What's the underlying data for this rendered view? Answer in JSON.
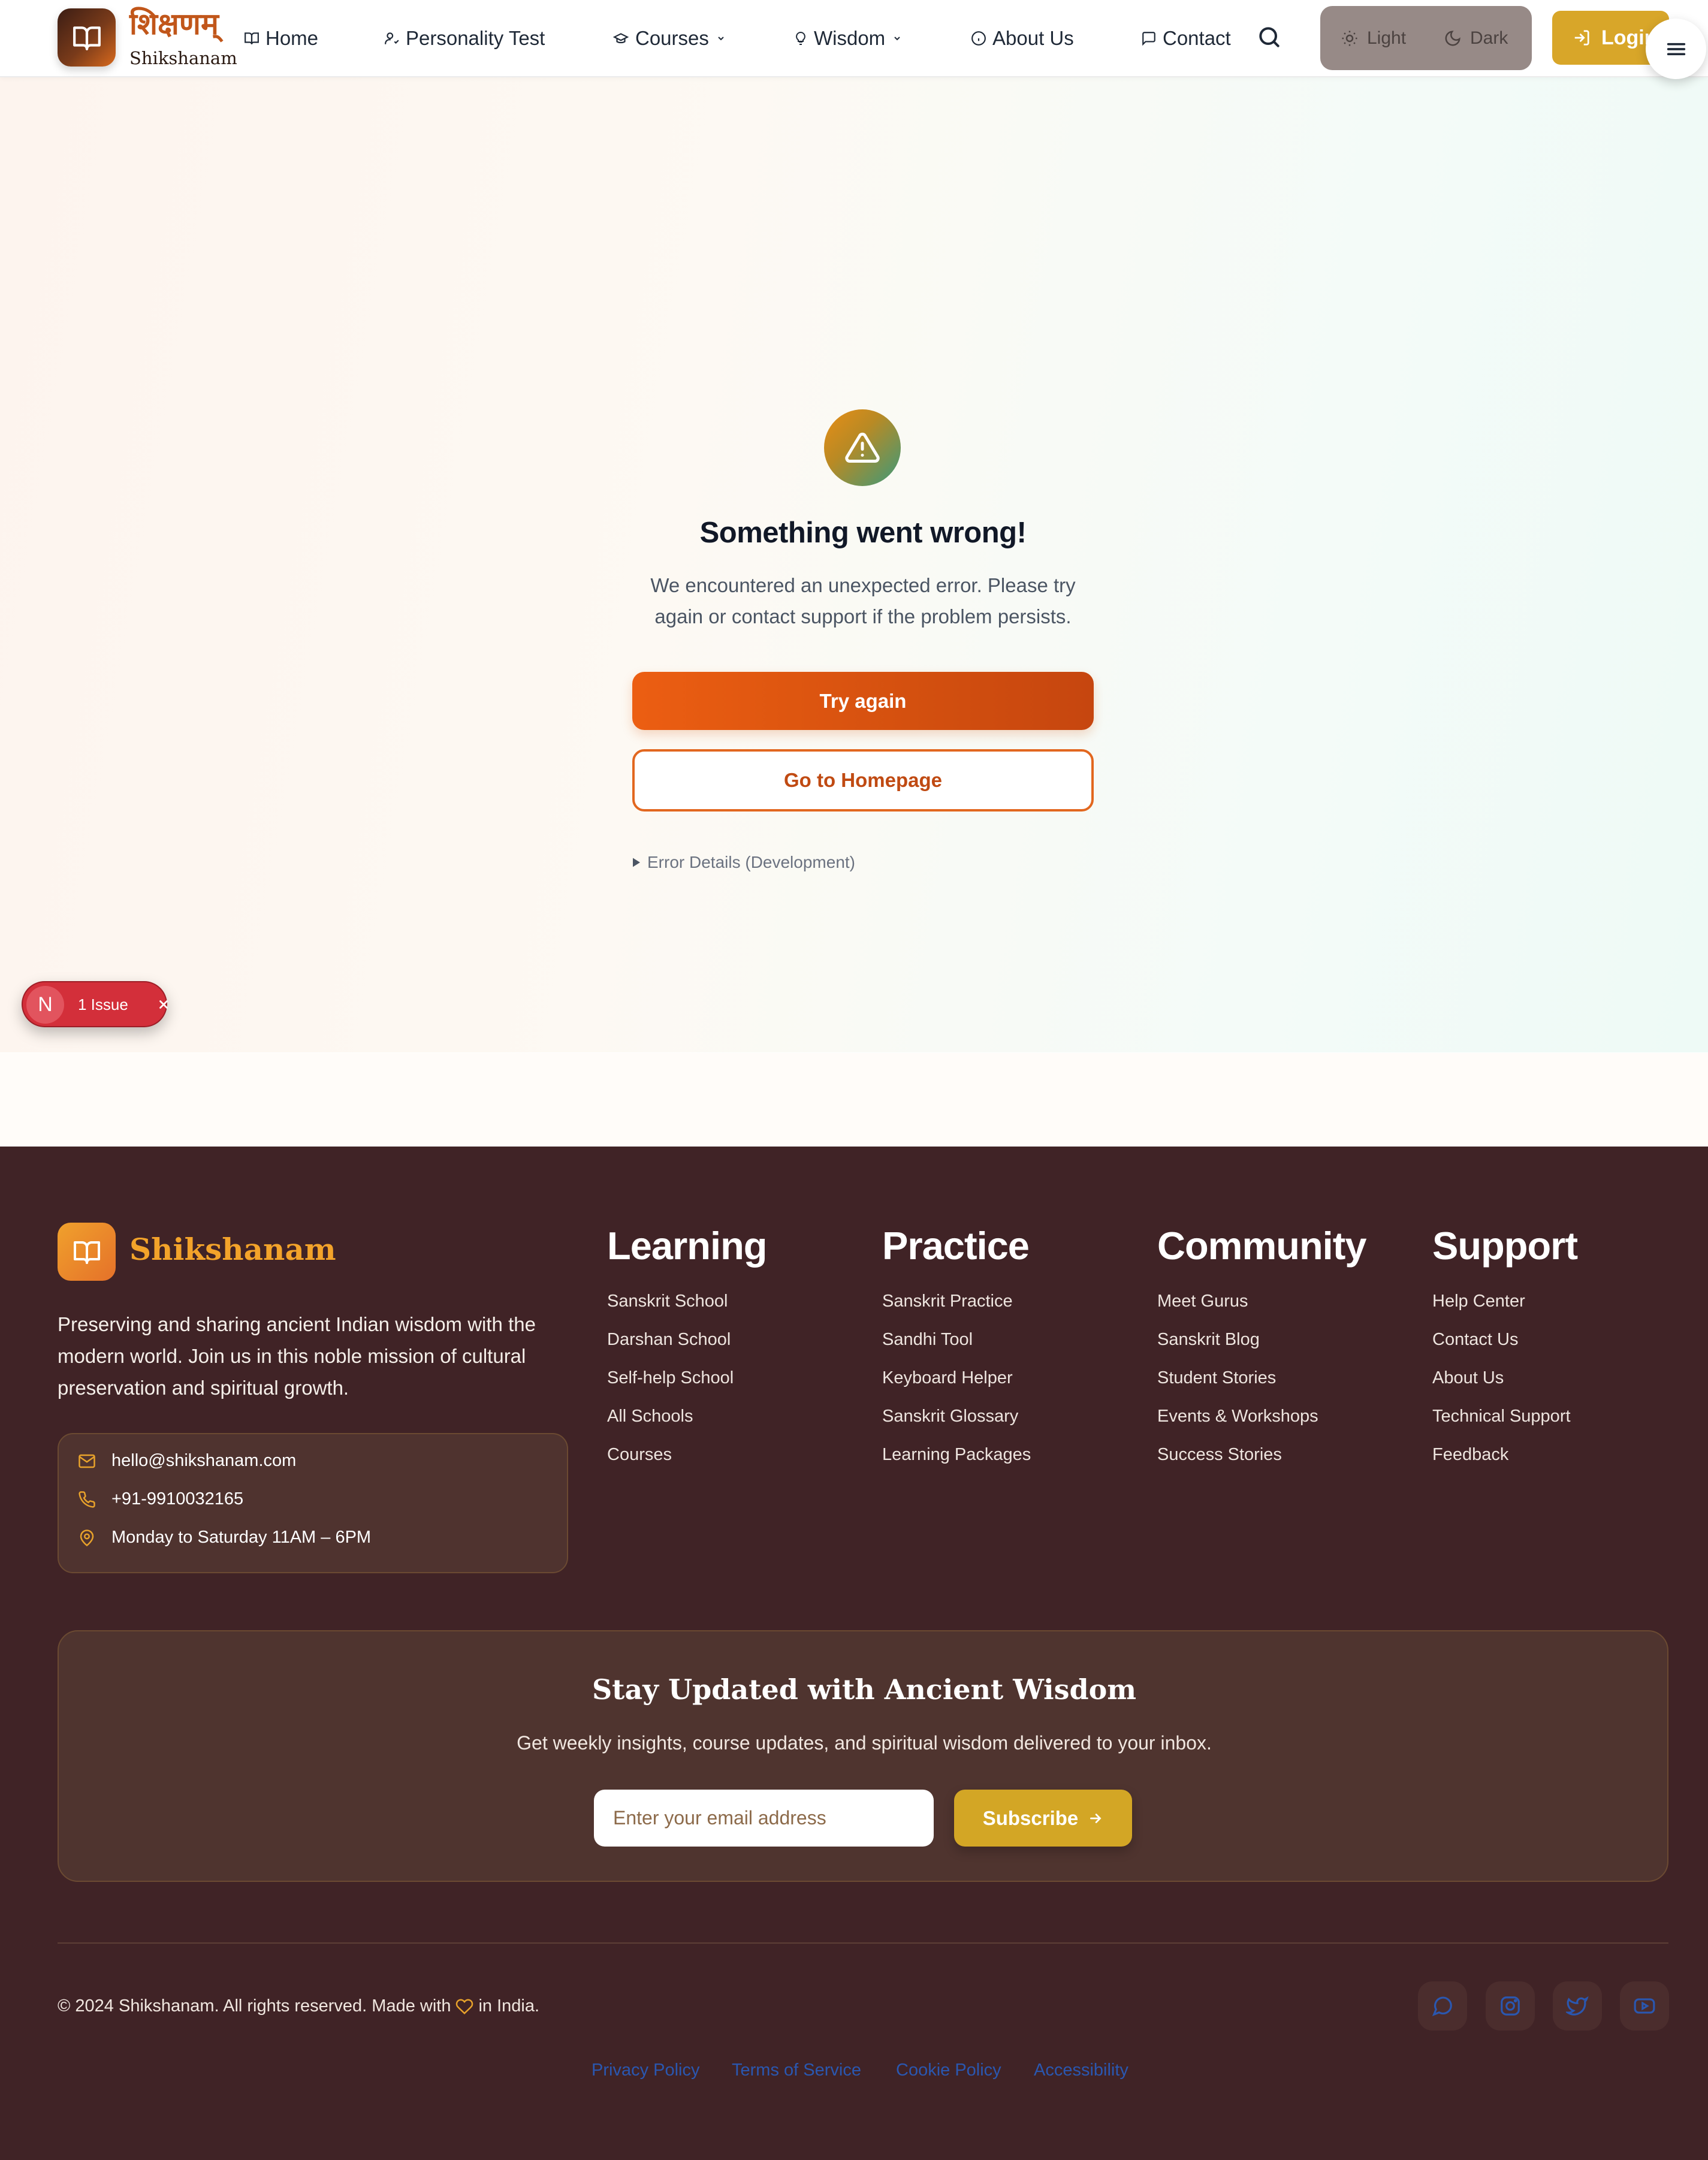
{
  "brand": {
    "devanagari": "शिक्षणम्",
    "latin": "Shikshanam",
    "logo_icon": "book-open-icon"
  },
  "nav": {
    "home": "Home",
    "personality_test": "Personality Test",
    "courses": "Courses",
    "wisdom": "Wisdom",
    "about": "About Us",
    "contact": "Contact",
    "theme_light": "Light",
    "theme_dark": "Dark",
    "login": "Login"
  },
  "error": {
    "title": "Something went wrong!",
    "message": "We encountered an unexpected error. Please try again or contact support if the problem persists.",
    "try_again": "Try again",
    "go_home": "Go to Homepage",
    "details": "Error Details (Development)"
  },
  "dev_overlay": {
    "badge_letter": "N",
    "issues": "1 Issue"
  },
  "footer": {
    "brand": "Shikshanam",
    "description": "Preserving and sharing ancient Indian wisdom with the modern world. Join us in this noble mission of cultural preservation and spiritual growth.",
    "contact": {
      "email": "hello@shikshanam.com",
      "phone": "+91-9910032165",
      "hours": "Monday to Saturday 11AM – 6PM"
    },
    "columns": [
      {
        "title": "Learning",
        "links": [
          "Sanskrit School",
          "Darshan School",
          "Self-help School",
          "All Schools",
          "Courses"
        ]
      },
      {
        "title": "Practice",
        "links": [
          "Sanskrit Practice",
          "Sandhi Tool",
          "Keyboard Helper",
          "Sanskrit Glossary",
          "Learning Packages"
        ]
      },
      {
        "title": "Community",
        "links": [
          "Meet Gurus",
          "Sanskrit Blog",
          "Student Stories",
          "Events & Workshops",
          "Success Stories"
        ]
      },
      {
        "title": "Support",
        "links": [
          "Help Center",
          "Contact Us",
          "About Us",
          "Technical Support",
          "Feedback"
        ]
      }
    ],
    "newsletter": {
      "title": "Stay Updated with Ancient Wisdom",
      "subtitle": "Get weekly insights, course updates, and spiritual wisdom delivered to your inbox.",
      "placeholder": "Enter your email address",
      "button": "Subscribe"
    },
    "copyright_prefix": "© 2024 Shikshanam. All rights reserved. Made with",
    "copyright_suffix": "in India.",
    "social": [
      "chat-icon",
      "instagram-icon",
      "twitter-icon",
      "youtube-icon"
    ],
    "legal": [
      "Privacy Policy",
      "Terms of Service",
      "Cookie Policy",
      "Accessibility"
    ]
  },
  "colors": {
    "primary_orange": "#e05a14",
    "gold": "#d8a629",
    "footer_bg": "#402326",
    "link_blue": "#2a57b0"
  }
}
